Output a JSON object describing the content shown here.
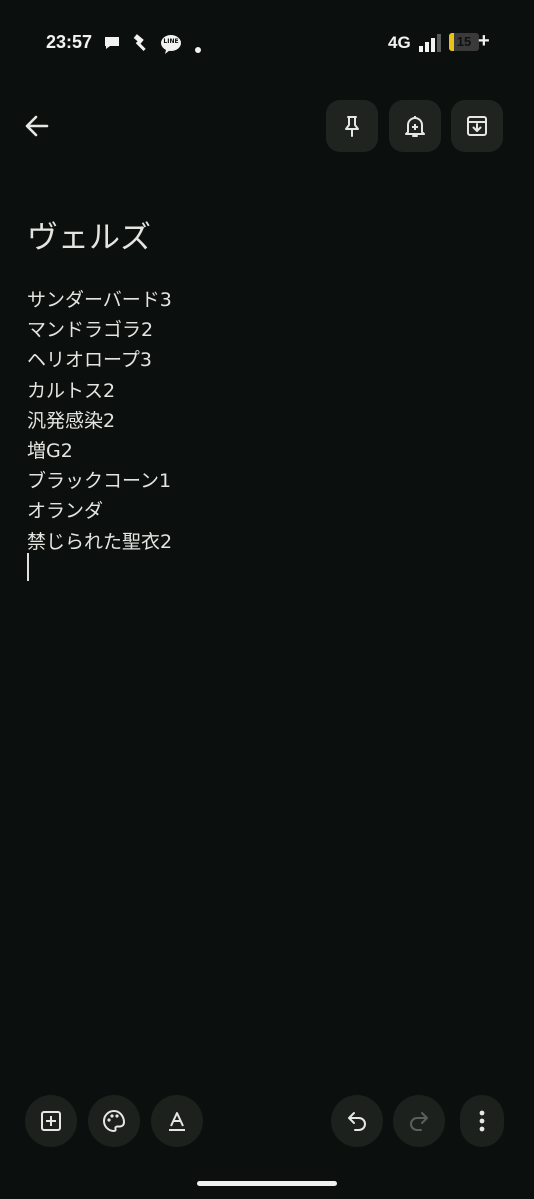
{
  "status_bar": {
    "time": "23:57",
    "network": "4G",
    "battery_level": "15",
    "battery_fraction": 0.15,
    "notification_icons": [
      "chat-bubble-icon",
      "hammer-icon",
      "line-app-icon",
      "dot-icon"
    ],
    "line_badge": "LINE"
  },
  "toolbar": {
    "back_icon": "arrow-back-icon",
    "pin_icon": "pin-icon",
    "reminder_icon": "bell-plus-icon",
    "archive_icon": "archive-icon"
  },
  "note": {
    "title": "ヴェルズ",
    "lines": [
      "サンダーバード3",
      "マンドラゴラ2",
      "ヘリオロープ3",
      "カルトス2",
      "汎発感染2",
      "増G2",
      "ブラックコーン1",
      "オランダ",
      "禁じられた聖衣2"
    ]
  },
  "bottom_bar": {
    "add_icon": "add-box-icon",
    "palette_icon": "palette-icon",
    "text_format_icon": "text-format-icon",
    "undo_icon": "undo-icon",
    "redo_icon": "redo-icon",
    "more_icon": "more-vert-icon"
  },
  "colors": {
    "background": "#0b100e",
    "button_bg": "#1f2421",
    "text": "#e4e4e0",
    "battery_accent": "#e8c21a"
  }
}
